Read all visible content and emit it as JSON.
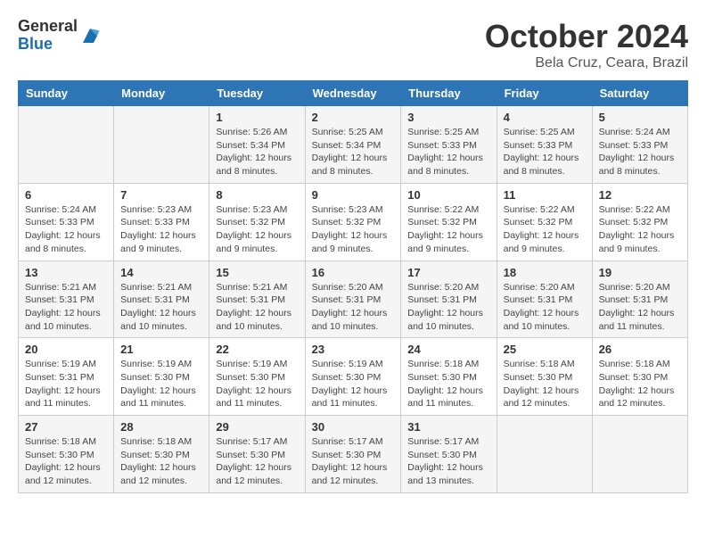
{
  "header": {
    "logo_general": "General",
    "logo_blue": "Blue",
    "month_title": "October 2024",
    "location": "Bela Cruz, Ceara, Brazil"
  },
  "weekdays": [
    "Sunday",
    "Monday",
    "Tuesday",
    "Wednesday",
    "Thursday",
    "Friday",
    "Saturday"
  ],
  "weeks": [
    [
      {
        "day": "",
        "info": ""
      },
      {
        "day": "",
        "info": ""
      },
      {
        "day": "1",
        "info": "Sunrise: 5:26 AM\nSunset: 5:34 PM\nDaylight: 12 hours and 8 minutes."
      },
      {
        "day": "2",
        "info": "Sunrise: 5:25 AM\nSunset: 5:34 PM\nDaylight: 12 hours and 8 minutes."
      },
      {
        "day": "3",
        "info": "Sunrise: 5:25 AM\nSunset: 5:33 PM\nDaylight: 12 hours and 8 minutes."
      },
      {
        "day": "4",
        "info": "Sunrise: 5:25 AM\nSunset: 5:33 PM\nDaylight: 12 hours and 8 minutes."
      },
      {
        "day": "5",
        "info": "Sunrise: 5:24 AM\nSunset: 5:33 PM\nDaylight: 12 hours and 8 minutes."
      }
    ],
    [
      {
        "day": "6",
        "info": "Sunrise: 5:24 AM\nSunset: 5:33 PM\nDaylight: 12 hours and 8 minutes."
      },
      {
        "day": "7",
        "info": "Sunrise: 5:23 AM\nSunset: 5:33 PM\nDaylight: 12 hours and 9 minutes."
      },
      {
        "day": "8",
        "info": "Sunrise: 5:23 AM\nSunset: 5:32 PM\nDaylight: 12 hours and 9 minutes."
      },
      {
        "day": "9",
        "info": "Sunrise: 5:23 AM\nSunset: 5:32 PM\nDaylight: 12 hours and 9 minutes."
      },
      {
        "day": "10",
        "info": "Sunrise: 5:22 AM\nSunset: 5:32 PM\nDaylight: 12 hours and 9 minutes."
      },
      {
        "day": "11",
        "info": "Sunrise: 5:22 AM\nSunset: 5:32 PM\nDaylight: 12 hours and 9 minutes."
      },
      {
        "day": "12",
        "info": "Sunrise: 5:22 AM\nSunset: 5:32 PM\nDaylight: 12 hours and 9 minutes."
      }
    ],
    [
      {
        "day": "13",
        "info": "Sunrise: 5:21 AM\nSunset: 5:31 PM\nDaylight: 12 hours and 10 minutes."
      },
      {
        "day": "14",
        "info": "Sunrise: 5:21 AM\nSunset: 5:31 PM\nDaylight: 12 hours and 10 minutes."
      },
      {
        "day": "15",
        "info": "Sunrise: 5:21 AM\nSunset: 5:31 PM\nDaylight: 12 hours and 10 minutes."
      },
      {
        "day": "16",
        "info": "Sunrise: 5:20 AM\nSunset: 5:31 PM\nDaylight: 12 hours and 10 minutes."
      },
      {
        "day": "17",
        "info": "Sunrise: 5:20 AM\nSunset: 5:31 PM\nDaylight: 12 hours and 10 minutes."
      },
      {
        "day": "18",
        "info": "Sunrise: 5:20 AM\nSunset: 5:31 PM\nDaylight: 12 hours and 10 minutes."
      },
      {
        "day": "19",
        "info": "Sunrise: 5:20 AM\nSunset: 5:31 PM\nDaylight: 12 hours and 11 minutes."
      }
    ],
    [
      {
        "day": "20",
        "info": "Sunrise: 5:19 AM\nSunset: 5:31 PM\nDaylight: 12 hours and 11 minutes."
      },
      {
        "day": "21",
        "info": "Sunrise: 5:19 AM\nSunset: 5:30 PM\nDaylight: 12 hours and 11 minutes."
      },
      {
        "day": "22",
        "info": "Sunrise: 5:19 AM\nSunset: 5:30 PM\nDaylight: 12 hours and 11 minutes."
      },
      {
        "day": "23",
        "info": "Sunrise: 5:19 AM\nSunset: 5:30 PM\nDaylight: 12 hours and 11 minutes."
      },
      {
        "day": "24",
        "info": "Sunrise: 5:18 AM\nSunset: 5:30 PM\nDaylight: 12 hours and 11 minutes."
      },
      {
        "day": "25",
        "info": "Sunrise: 5:18 AM\nSunset: 5:30 PM\nDaylight: 12 hours and 12 minutes."
      },
      {
        "day": "26",
        "info": "Sunrise: 5:18 AM\nSunset: 5:30 PM\nDaylight: 12 hours and 12 minutes."
      }
    ],
    [
      {
        "day": "27",
        "info": "Sunrise: 5:18 AM\nSunset: 5:30 PM\nDaylight: 12 hours and 12 minutes."
      },
      {
        "day": "28",
        "info": "Sunrise: 5:18 AM\nSunset: 5:30 PM\nDaylight: 12 hours and 12 minutes."
      },
      {
        "day": "29",
        "info": "Sunrise: 5:17 AM\nSunset: 5:30 PM\nDaylight: 12 hours and 12 minutes."
      },
      {
        "day": "30",
        "info": "Sunrise: 5:17 AM\nSunset: 5:30 PM\nDaylight: 12 hours and 12 minutes."
      },
      {
        "day": "31",
        "info": "Sunrise: 5:17 AM\nSunset: 5:30 PM\nDaylight: 12 hours and 13 minutes."
      },
      {
        "day": "",
        "info": ""
      },
      {
        "day": "",
        "info": ""
      }
    ]
  ]
}
